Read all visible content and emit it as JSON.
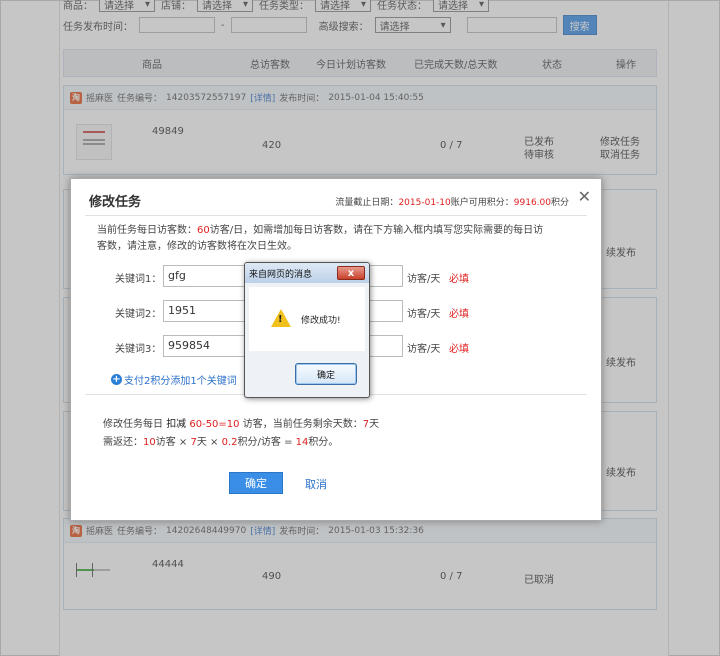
{
  "filter": {
    "row1_label_1": "商品：",
    "row1_label_2": "店铺：",
    "row1_label_3": "任务类型：",
    "row1_label_4": "任务状态：",
    "row1_select_value": "请选择",
    "publish_time_label": "任务发布时间：",
    "date_sep": "-",
    "advanced_search_label": "高级搜索：",
    "advanced_search_value": "请选择",
    "search_button": "搜索"
  },
  "table": {
    "headers": [
      "商品",
      "总访客数",
      "今日计划访客数",
      "已完成天数/总天数",
      "状态",
      "操作"
    ]
  },
  "tasks": [
    {
      "shop": "摇麻医",
      "task_no_label": "任务编号：",
      "task_no": "14203572557197",
      "detail": "[详情]",
      "publish_label": "发布时间：",
      "publish_time": "2015-01-04 15:40:55",
      "product_id": "49849",
      "total_visitors": "420",
      "days": "0 / 7",
      "status_1": "已发布",
      "status_2": "待审核",
      "op_1": "修改任务",
      "op_2": "取消任务"
    },
    {
      "shop": "摇麻医",
      "task_no_label": "任务编号：",
      "task_no": "14202648449970",
      "detail": "[详情]",
      "publish_label": "发布时间：",
      "publish_time": "2015-01-03 15:32:36",
      "product_id": "44444",
      "total_visitors": "490",
      "days": "0 / 7",
      "status_1": "已取消"
    }
  ],
  "side_links": [
    "续发布",
    "续发布",
    "续发布"
  ],
  "modal": {
    "title": "修改任务",
    "deadline_label": "流量截止日期：",
    "deadline": "2015-01-10",
    "points_label": "账户可用积分：",
    "points": "9916.00",
    "points_unit": "积分",
    "close": "✕",
    "notice_1": "当前任务每日访客数：",
    "notice_value": "60",
    "notice_2": "访客/日，如需增加每日访客数，请在下方输入框内填写您实际需要的每日访客数，请注意，修改的访客数将在次日生效。",
    "keywords": [
      {
        "label": "关键词1：",
        "value": "gfg",
        "unit": "访客/天",
        "required": "必填"
      },
      {
        "label": "关键词2：",
        "value": "1951",
        "unit": "访客/天",
        "required": "必填"
      },
      {
        "label": "关键词3：",
        "value": "959854",
        "unit": "访客/天",
        "required": "必填"
      }
    ],
    "add_keyword": "支付2积分添加1个关键词",
    "summary_1a": "修改任务每日 ",
    "summary_1b": "扣减",
    "summary_1c": " 60-50=10",
    "summary_1d": " 访客，当前任务剩余天数：",
    "summary_1e": "7",
    "summary_1f": "天",
    "summary_2a": "需返还：",
    "summary_2b": "10",
    "summary_2c": "访客 × ",
    "summary_2d": "7",
    "summary_2e": "天 × ",
    "summary_2f": "0.2",
    "summary_2g": "积分/访客 = ",
    "summary_2h": "14",
    "summary_2i": "积分。",
    "confirm": "确定",
    "cancel": "取消"
  },
  "msgbox": {
    "title": "来自网页的消息",
    "close": "x",
    "message": "修改成功!",
    "ok": "确定"
  },
  "colors": {
    "accent": "#3a8ee6",
    "link": "#2a6fc9",
    "emphasis": "#e02020"
  }
}
